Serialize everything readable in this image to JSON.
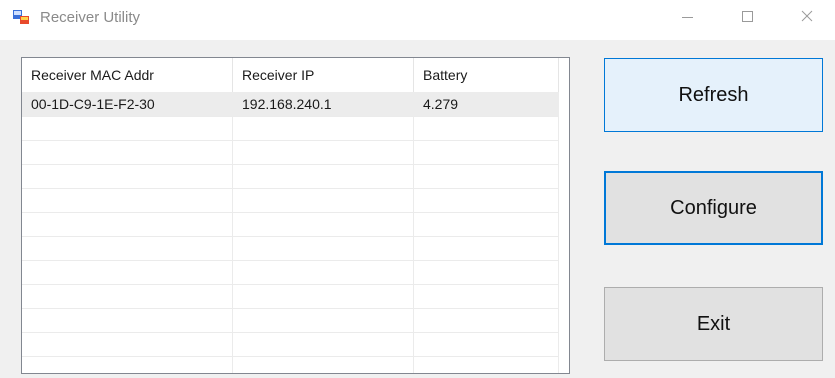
{
  "window": {
    "title": "Receiver Utility"
  },
  "table": {
    "columns": [
      "Receiver MAC Addr",
      "Receiver IP",
      "Battery"
    ],
    "rows": [
      {
        "mac": "00-1D-C9-1E-F2-30",
        "ip": "192.168.240.1",
        "battery": "4.279"
      }
    ]
  },
  "buttons": {
    "refresh": "Refresh",
    "configure": "Configure",
    "exit": "Exit"
  },
  "colors": {
    "accent": "#0078d7",
    "selected_button_bg": "#e5f1fb",
    "button_bg": "#e1e1e1"
  }
}
